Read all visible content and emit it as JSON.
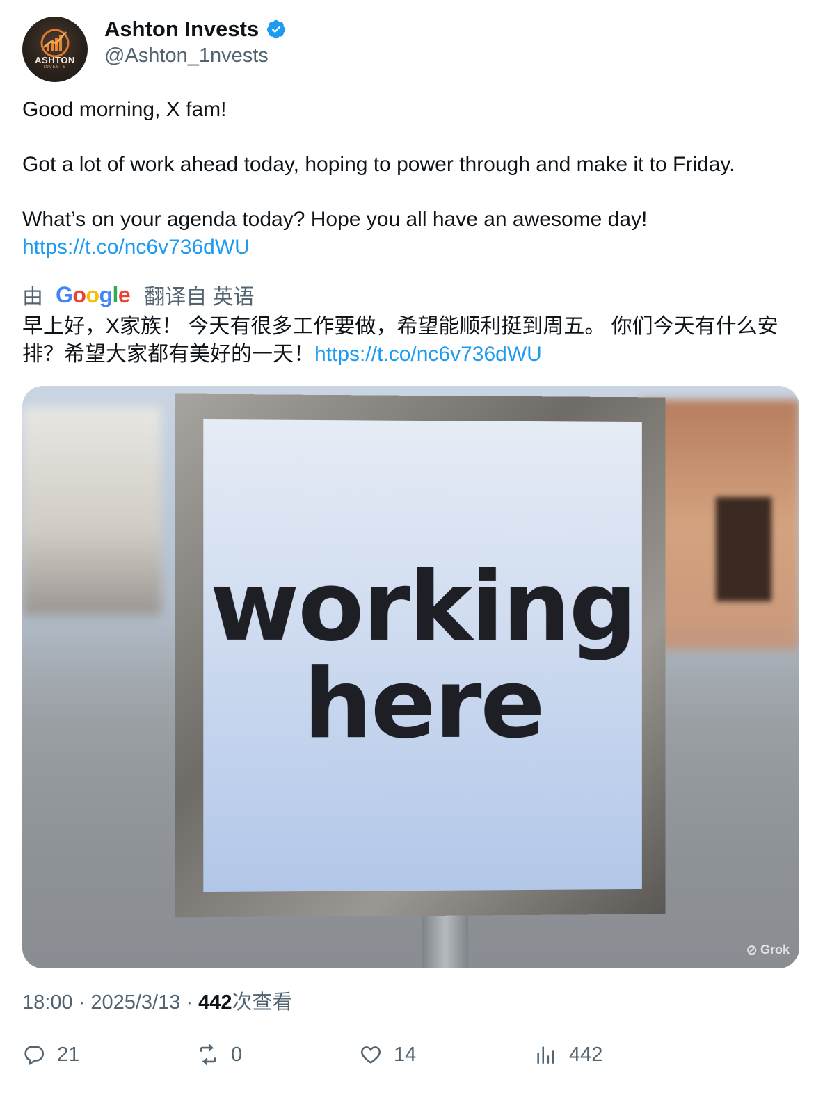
{
  "user": {
    "display_name": "Ashton Invests",
    "handle": "@Ashton_1nvests",
    "avatar_text": "ASHTON",
    "avatar_subtext": "INVESTS"
  },
  "tweet": {
    "line1": "Good morning, X fam!",
    "line2": "Got a lot of work ahead today, hoping to power through and make it to Friday.",
    "line3": "What’s on your agenda today? Hope you all have an awesome day!",
    "link": "https://t.co/nc6v736dWU"
  },
  "translation": {
    "prefix": "由",
    "provider": "Google",
    "suffix": "翻译自 英语",
    "text": "早上好，X家族！ 今天有很多工作要做，希望能顺利挺到周五。 你们今天有什么安排？希望大家都有美好的一天！",
    "link": "https://t.co/nc6v736dWU"
  },
  "media": {
    "sign_line1": "working",
    "sign_line2": "here",
    "watermark": "Grok"
  },
  "meta": {
    "time": "18:00",
    "date": "2025/3/13",
    "views_count": "442",
    "views_label": "次查看"
  },
  "actions": {
    "replies": "21",
    "reposts": "0",
    "likes": "14",
    "views": "442"
  }
}
